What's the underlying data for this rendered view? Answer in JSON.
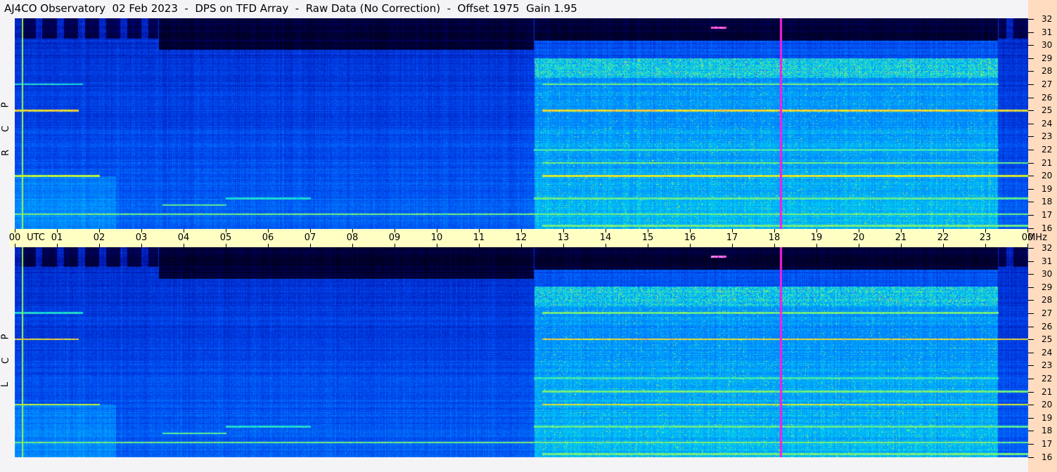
{
  "title": "AJ4CO Observatory  02 Feb 2023  -  DPS on TFD Array  -  Raw Data (No Correction)  -  Offset 1975  Gain 1.95",
  "chart_data": {
    "type": "heatmap",
    "title": "AJ4CO Observatory  02 Feb 2023  -  DPS on TFD Array  -  Raw Data (No Correction)  -  Offset 1975  Gain 1.95",
    "xlabel": "UTC",
    "ylabel": "MHz",
    "x_range": [
      0,
      24
    ],
    "y_range": [
      16,
      32
    ],
    "x_ticks": [
      "00",
      "01",
      "02",
      "03",
      "04",
      "05",
      "06",
      "07",
      "08",
      "09",
      "10",
      "11",
      "12",
      "13",
      "14",
      "15",
      "16",
      "17",
      "18",
      "19",
      "20",
      "21",
      "22",
      "23",
      "00"
    ],
    "y_ticks": [
      "32",
      "31",
      "30",
      "29",
      "28",
      "27",
      "26",
      "25",
      "24",
      "23",
      "22",
      "21",
      "20",
      "19",
      "18",
      "17",
      "16"
    ],
    "panels": [
      {
        "name": "top",
        "label": [
          "R",
          "C",
          "P"
        ]
      },
      {
        "name": "bottom",
        "label": [
          "L",
          "C",
          "P"
        ]
      }
    ],
    "unit_label": "MHz",
    "utc_label": "UTC",
    "vertical_markers_utc": [
      0.17,
      18.15
    ],
    "bands": [
      [
        25,
        0,
        1.5,
        0.9
      ],
      [
        25,
        12.5,
        24,
        0.9
      ],
      [
        20,
        0,
        2,
        0.85
      ],
      [
        20,
        12.5,
        24,
        0.88
      ],
      [
        17.1,
        0,
        24,
        0.8
      ],
      [
        21,
        12.5,
        24,
        0.8
      ],
      [
        27,
        0,
        1.6,
        0.72
      ],
      [
        27,
        12.5,
        23.3,
        0.8
      ],
      [
        18.3,
        12.3,
        24,
        0.78
      ],
      [
        22,
        12.3,
        23.3,
        0.75
      ],
      [
        16.2,
        12.5,
        24,
        0.8
      ],
      [
        17.8,
        3.5,
        5,
        0.78
      ],
      [
        18.3,
        5,
        7,
        0.72
      ],
      [
        31.3,
        16.5,
        16.85,
        1.0
      ]
    ]
  }
}
